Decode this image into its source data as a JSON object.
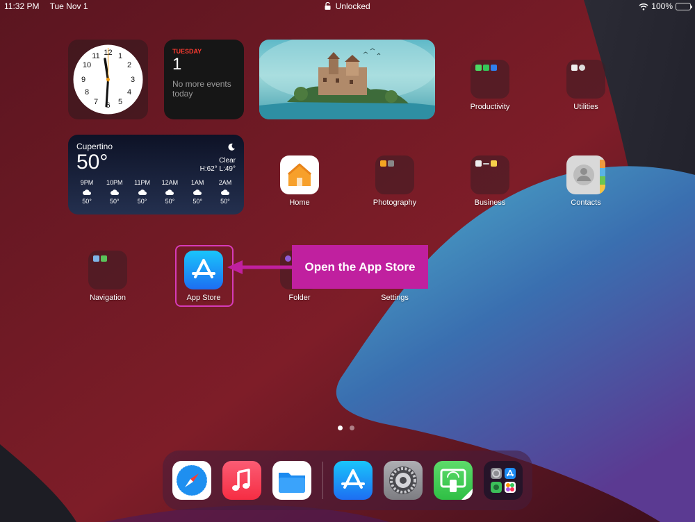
{
  "status_bar": {
    "time": "11:32 PM",
    "date": "Tue Nov 1",
    "lock_status": "Unlocked",
    "battery": "100%"
  },
  "widgets": {
    "clock": {
      "numbers": [
        "12",
        "1",
        "2",
        "3",
        "4",
        "5",
        "6",
        "7",
        "8",
        "9",
        "10",
        "11"
      ]
    },
    "calendar": {
      "day": "TUESDAY",
      "date": "1",
      "note": "No more events today"
    },
    "weather": {
      "city": "Cupertino",
      "temp": "50°",
      "condition": "Clear",
      "hilo": "H:62° L:49°",
      "hours": [
        {
          "time": "9PM",
          "temp": "50°"
        },
        {
          "time": "10PM",
          "temp": "50°"
        },
        {
          "time": "11PM",
          "temp": "50°"
        },
        {
          "time": "12AM",
          "temp": "50°"
        },
        {
          "time": "1AM",
          "temp": "50°"
        },
        {
          "time": "2AM",
          "temp": "50°"
        }
      ]
    }
  },
  "apps": {
    "productivity": "Productivity",
    "utilities": "Utilities",
    "home": "Home",
    "photography": "Photography",
    "business": "Business",
    "contacts": "Contacts",
    "navigation": "Navigation",
    "app_store": "App Store",
    "folder": "Folder",
    "settings": "Settings"
  },
  "callout": {
    "text": "Open the App Store"
  },
  "dock": {
    "apps": [
      "safari-icon",
      "music-icon",
      "files-icon",
      "app-store-icon",
      "settings-icon",
      "screen-mirroring-icon",
      "app-library-icon"
    ]
  },
  "colors": {
    "accent": "#c0209f",
    "highlight_border": "#d63bb8"
  }
}
